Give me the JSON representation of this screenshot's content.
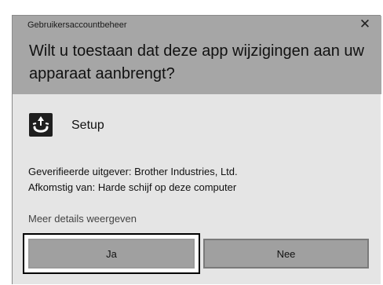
{
  "dialog": {
    "caption": "Gebruikersaccountbeheer",
    "close_glyph": "✕",
    "question": "Wilt u toestaan dat deze app wijzigingen aan uw apparaat aanbrengt?"
  },
  "app": {
    "icon": "setup-icon",
    "name": "Setup"
  },
  "details": {
    "publisher": "Geverifieerde uitgever: Brother Industries, Ltd.",
    "origin": "Afkomstig van: Harde schijf op deze computer"
  },
  "more_details": "Meer details weergeven",
  "buttons": {
    "yes": "Ja",
    "no": "Nee"
  },
  "colors": {
    "header": "#a6a6a6",
    "body": "#e5e5e5",
    "button": "#a0a0a0",
    "focus": "#000000"
  }
}
